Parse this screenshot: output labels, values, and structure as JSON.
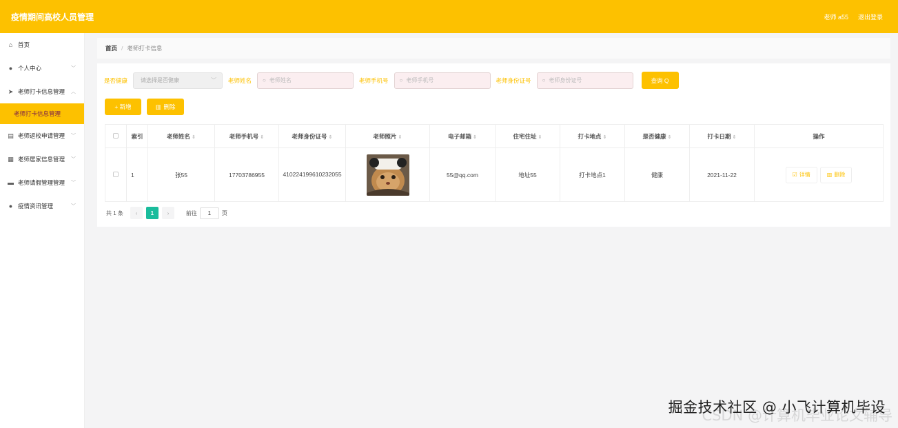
{
  "app": {
    "title": "疫情期间高校人员管理",
    "user": "老师 a55",
    "logout": "退出登录"
  },
  "sidebar": {
    "items": [
      {
        "label": "首页",
        "icon": "home-icon",
        "glyph": "⌂",
        "chevron": ""
      },
      {
        "label": "个人中心",
        "icon": "user-icon",
        "glyph": "●",
        "chevron": "﹀"
      },
      {
        "label": "老师打卡信息管理",
        "icon": "send-icon",
        "glyph": "➤",
        "chevron": "︿"
      },
      {
        "label": "老师打卡信息管理",
        "icon": "",
        "glyph": "",
        "chevron": "",
        "active": true
      },
      {
        "label": "老师返校申请管理",
        "icon": "doc-icon",
        "glyph": "▤",
        "chevron": "﹀"
      },
      {
        "label": "老师居家信息管理",
        "icon": "grid-icon",
        "glyph": "▦",
        "chevron": "﹀"
      },
      {
        "label": "老师请假管理管理",
        "icon": "chat-icon",
        "glyph": "▬",
        "chevron": "﹀"
      },
      {
        "label": "疫情资讯管理",
        "icon": "pin-icon",
        "glyph": "●",
        "chevron": "﹀"
      }
    ]
  },
  "breadcrumb": {
    "home": "首页",
    "separator": "/",
    "current": "老师打卡信息"
  },
  "search": {
    "health_label": "是否健康",
    "health_placeholder": "请选择是否健康",
    "name_label": "老师姓名",
    "name_placeholder": "老师姓名",
    "phone_label": "老师手机号",
    "phone_placeholder": "老师手机号",
    "idcard_label": "老师身份证号",
    "idcard_placeholder": "老师身份证号",
    "query": "查询 Q"
  },
  "actions": {
    "add": "+ 新增",
    "delete": "删除"
  },
  "table": {
    "headers": [
      "索引",
      "老师姓名",
      "老师手机号",
      "老师身份证号",
      "老师照片",
      "电子邮箱",
      "住宅住址",
      "打卡地点",
      "是否健康",
      "打卡日期",
      "操作"
    ],
    "rows": [
      {
        "index": "1",
        "name": "张55",
        "phone": "17703786955",
        "idcard": "410224199610232055",
        "email": "55@qq.com",
        "address": "地址55",
        "checkin_place": "打卡地点1",
        "healthy": "健康",
        "date": "2021-11-22",
        "detail": "详情",
        "delete": "删除"
      }
    ]
  },
  "pagination": {
    "total": "共 1 条",
    "current_page": "1",
    "goto_label": "前往",
    "goto_value": "1",
    "page_unit": "页"
  },
  "watermark": {
    "line1": "掘金技术社区 @ 小飞计算机毕设",
    "line2": "CSDN @计算机毕业论文辅导"
  },
  "colors": {
    "accent": "#fdc100",
    "pager_active": "#1abc9c"
  }
}
